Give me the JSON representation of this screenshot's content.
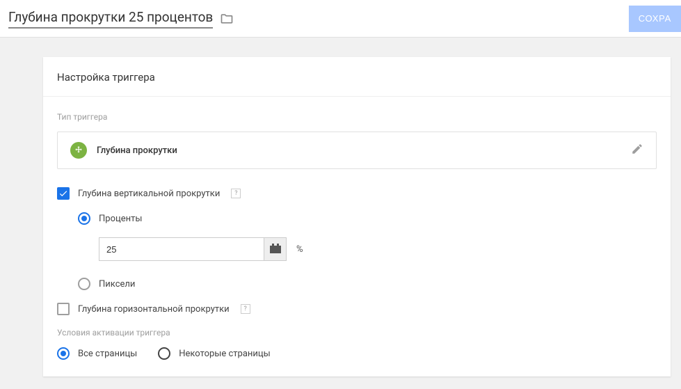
{
  "header": {
    "title": "Глубина прокрутки 25 процентов",
    "save_button": "СОХРА"
  },
  "card": {
    "title": "Настройка триггера",
    "trigger_type_label": "Тип триггера",
    "trigger_type_value": "Глубина прокрутки",
    "vertical_scroll": {
      "label": "Глубина вертикальной прокрутки",
      "checked": true,
      "percent_label": "Проценты",
      "percent_value": "25",
      "percent_sign": "%",
      "pixels_label": "Пиксели"
    },
    "horizontal_scroll": {
      "label": "Глубина горизонтальной прокрутки",
      "checked": false
    },
    "activation": {
      "label": "Условия активации триггера",
      "all_pages": "Все страницы",
      "some_pages": "Некоторые страницы"
    }
  }
}
